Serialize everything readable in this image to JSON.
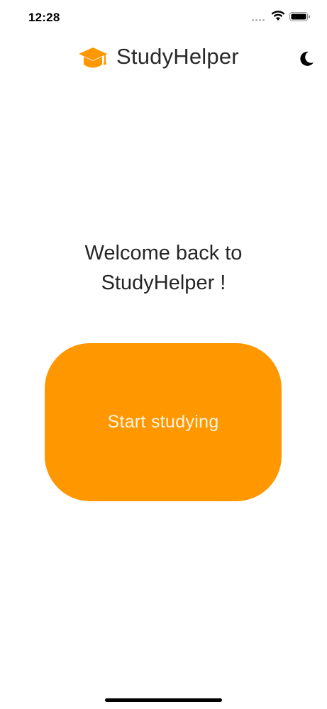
{
  "status_bar": {
    "time": "12:28",
    "signal_icon": "signal-dots-icon",
    "wifi_icon": "wifi-icon",
    "battery_icon": "battery-icon"
  },
  "header": {
    "logo_icon": "graduation-cap-icon",
    "title": "StudyHelper",
    "theme_toggle_icon": "moon-icon"
  },
  "welcome": {
    "line1": "Welcome back to",
    "line2": "StudyHelper !"
  },
  "start_button": {
    "label": "Start studying"
  },
  "colors": {
    "accent": "#ff9800",
    "button_text": "#fff3df",
    "text": "#262626",
    "background": "#ffffff"
  }
}
